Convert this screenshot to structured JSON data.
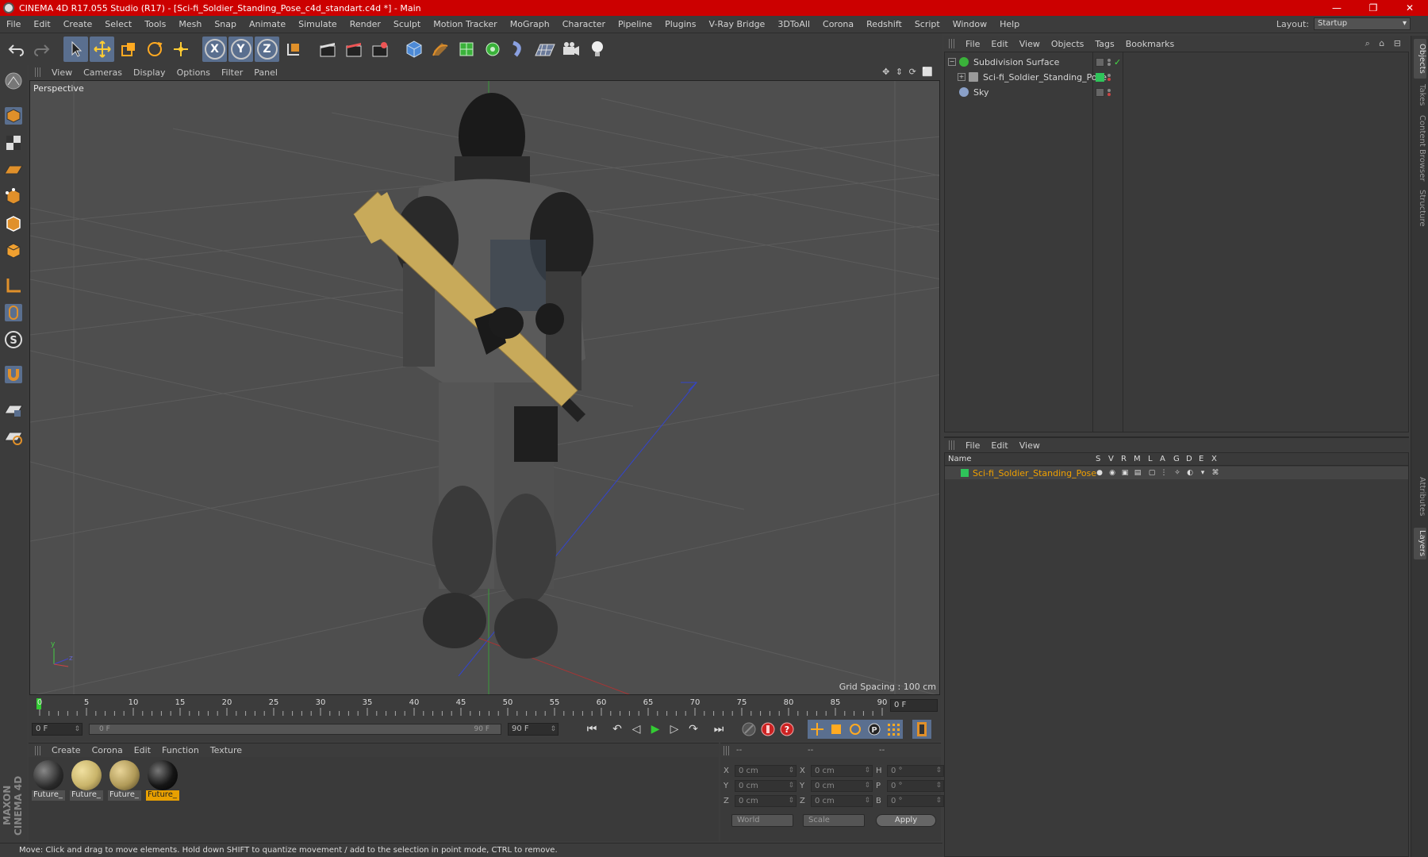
{
  "window": {
    "title": "CINEMA 4D R17.055 Studio (R17) - [Sci-fi_Soldier_Standing_Pose_c4d_standart.c4d *] - Main",
    "minimize": "—",
    "restore": "❐",
    "close": "✕"
  },
  "menu": [
    "File",
    "Edit",
    "Create",
    "Select",
    "Tools",
    "Mesh",
    "Snap",
    "Animate",
    "Simulate",
    "Render",
    "Sculpt",
    "Motion Tracker",
    "MoGraph",
    "Character",
    "Pipeline",
    "Plugins",
    "V-Ray Bridge",
    "3DToAll",
    "Corona",
    "Redshift",
    "Script",
    "Window",
    "Help"
  ],
  "layout": {
    "label": "Layout:",
    "value": "Startup"
  },
  "toolbar": {
    "axis_x": "X",
    "axis_y": "Y",
    "axis_z": "Z"
  },
  "viewport": {
    "menu": [
      "View",
      "Cameras",
      "Display",
      "Options",
      "Filter",
      "Panel"
    ],
    "nav_icons": "✥ ⇕ ⟳ ⬜",
    "camera_label": "Perspective",
    "grid_spacing": "Grid Spacing : 100 cm"
  },
  "timeline": {
    "ticks": [
      "0",
      "5",
      "10",
      "15",
      "20",
      "25",
      "30",
      "35",
      "40",
      "45",
      "50",
      "55",
      "60",
      "65",
      "70",
      "75",
      "80",
      "85",
      "90"
    ],
    "current_frame": "0 F"
  },
  "transport": {
    "start_field": "0 F",
    "slider_start": "0 F",
    "slider_end": "90 F",
    "end_field": "90 F",
    "btn_first": "⏮",
    "btn_prev_key": "↶",
    "btn_prev": "◁",
    "btn_play": "▶",
    "btn_next": "▷",
    "btn_next_key": "↷",
    "btn_last": "⏭"
  },
  "materials": {
    "menu": [
      "Create",
      "Corona",
      "Edit",
      "Function",
      "Texture"
    ],
    "items": [
      {
        "label": "Future_",
        "color": "#2a2a2a",
        "selected": false
      },
      {
        "label": "Future_",
        "color": "#c9b46a",
        "selected": false
      },
      {
        "label": "Future_",
        "color": "#b09a58",
        "selected": false
      },
      {
        "label": "Future_",
        "color": "#151515",
        "selected": true
      }
    ]
  },
  "coords": {
    "head_1": "--",
    "head_2": "--",
    "head_3": "--",
    "rows": [
      {
        "a1": "X",
        "v1": "0 cm",
        "a2": "X",
        "v2": "0 cm",
        "a3": "H",
        "v3": "0 °"
      },
      {
        "a1": "Y",
        "v1": "0 cm",
        "a2": "Y",
        "v2": "0 cm",
        "a3": "P",
        "v3": "0 °"
      },
      {
        "a1": "Z",
        "v1": "0 cm",
        "a2": "Z",
        "v2": "0 cm",
        "a3": "B",
        "v3": "0 °"
      }
    ],
    "world": "World",
    "scale": "Scale",
    "apply": "Apply"
  },
  "status": "Move: Click and drag to move elements. Hold down SHIFT to quantize movement / add to the selection in point mode, CTRL to remove.",
  "object_manager": {
    "menu": [
      "File",
      "Edit",
      "View",
      "Objects",
      "Tags",
      "Bookmarks"
    ],
    "icons": "⌕ ⌂ ⊟",
    "objects": [
      {
        "name": "Subdivision Surface",
        "tree": "−",
        "icon_color": "#3ab23a"
      },
      {
        "name": "Sci-fi_Soldier_Standing_Pose",
        "tree": "+",
        "icon_color": "#9a9a9a"
      },
      {
        "name": "Sky",
        "tree": "",
        "icon_color": "#8aa0c8"
      }
    ],
    "check": "✓"
  },
  "layer_manager": {
    "menu": [
      "File",
      "Edit",
      "View"
    ],
    "columns": [
      "Name",
      "S",
      "V",
      "R",
      "M",
      "L",
      "A",
      "G",
      "D",
      "E",
      "X"
    ],
    "layer_name": "Sci-fi_Soldier_Standing_Pose"
  },
  "right_tabs": [
    "Objects",
    "Takes",
    "Content Browser",
    "Structure",
    "Attributes",
    "Layers"
  ],
  "maxon_logo": "MAXON CINEMA 4D"
}
